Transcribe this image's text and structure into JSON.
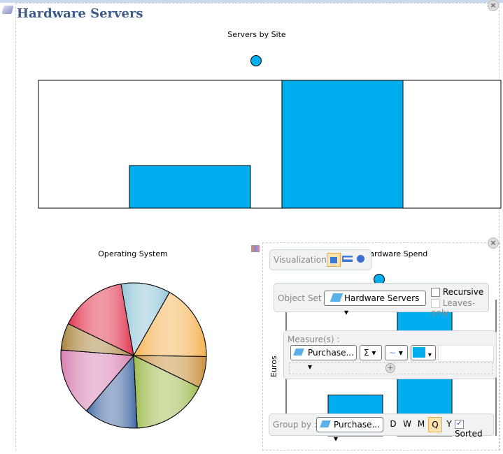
{
  "title": "Hardware Servers",
  "colors": {
    "bar": "#00adee",
    "title": "#3d5a8a"
  },
  "chart_data": [
    {
      "type": "bar",
      "title": "Servers by Site",
      "categories": [
        "",
        ""
      ],
      "values": [
        1,
        3
      ],
      "ylim": [
        0,
        3
      ]
    },
    {
      "type": "pie",
      "title": "Operating System",
      "values": [
        11,
        17,
        7,
        17,
        12,
        15,
        6,
        15
      ],
      "colors": [
        "#8fc3d8",
        "#f6b14f",
        "#c98f3b",
        "#9dbb4d",
        "#3d64a0",
        "#d77fb0",
        "#a8833a",
        "#e0304a"
      ]
    },
    {
      "type": "bar",
      "title": "Hardware Spend",
      "ylabel": "Euros",
      "categories": [
        "",
        ""
      ],
      "values": [
        0.3,
        1
      ]
    }
  ],
  "config": {
    "visualization_label": "Visualization :",
    "object_set_label": "Object Set :",
    "object_set_value": "Hardware Servers",
    "recursive": "Recursive",
    "leaves_only": "Leaves-only",
    "measures_label": "Measure(s) :",
    "measure_value": "Purchase...",
    "aggregate": "Σ",
    "group_by_label": "Group by :",
    "group_by_value": "Purchase...",
    "periods": [
      "D",
      "W",
      "M",
      "Q",
      "Y"
    ],
    "selected_period": "Q",
    "sorted": "Sorted"
  }
}
